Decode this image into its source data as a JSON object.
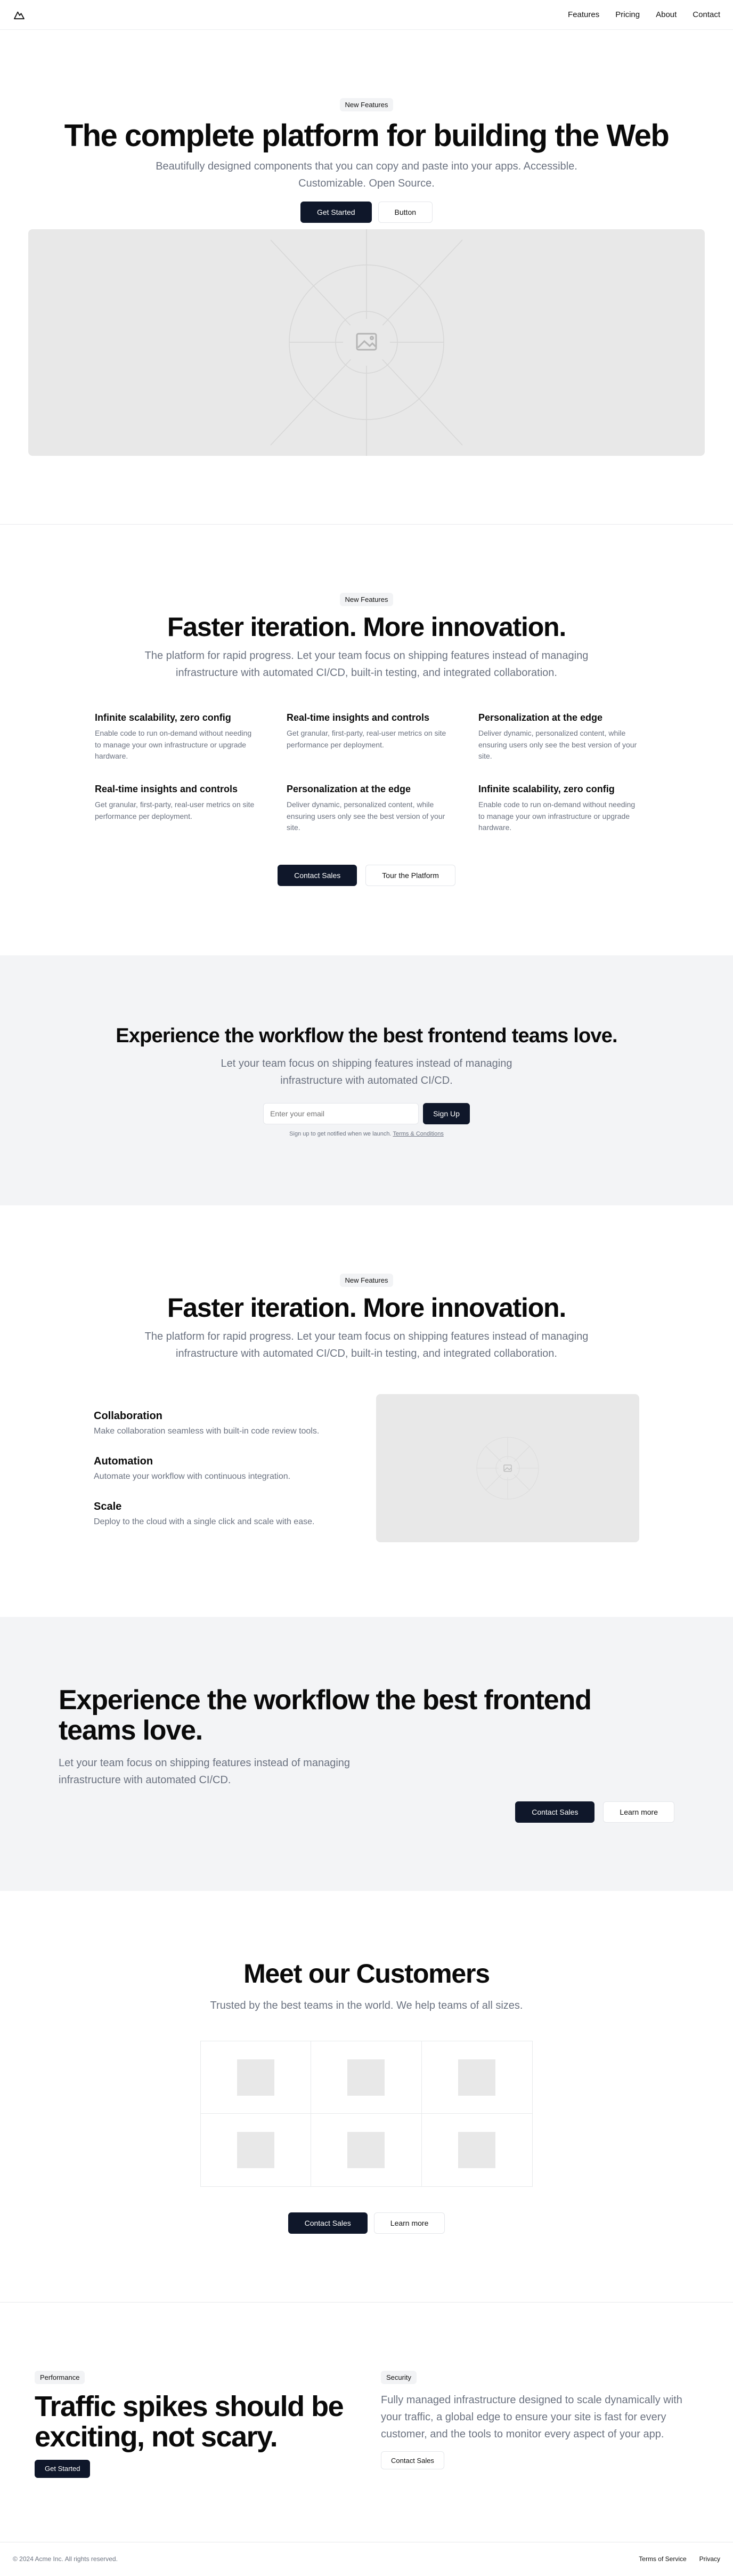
{
  "nav": {
    "items": [
      "Features",
      "Pricing",
      "About",
      "Contact"
    ]
  },
  "hero": {
    "badge": "New Features",
    "title": "The complete platform for building the Web",
    "subtitle": "Beautifully designed components that you can copy and paste into your apps. Accessible. Customizable. Open Source.",
    "primary": "Get Started",
    "secondary": "Button"
  },
  "features": {
    "badge": "New Features",
    "title": "Faster iteration. More innovation.",
    "subtitle": "The platform for rapid progress. Let your team focus on shipping features instead of managing infrastructure with automated CI/CD, built-in testing, and integrated collaboration.",
    "items": [
      {
        "title": "Infinite scalability, zero config",
        "desc": "Enable code to run on-demand without needing to manage your own infrastructure or upgrade hardware."
      },
      {
        "title": "Real-time insights and controls",
        "desc": "Get granular, first-party, real-user metrics on site performance per deployment."
      },
      {
        "title": "Personalization at the edge",
        "desc": "Deliver dynamic, personalized content, while ensuring users only see the best version of your site."
      },
      {
        "title": "Real-time insights and controls",
        "desc": "Get granular, first-party, real-user metrics on site performance per deployment."
      },
      {
        "title": "Personalization at the edge",
        "desc": "Deliver dynamic, personalized content, while ensuring users only see the best version of your site."
      },
      {
        "title": "Infinite scalability, zero config",
        "desc": "Enable code to run on-demand without needing to manage your own infrastructure or upgrade hardware."
      }
    ],
    "primary": "Contact Sales",
    "secondary": "Tour the Platform"
  },
  "cta_email": {
    "title": "Experience the workflow the best frontend teams love.",
    "subtitle": "Let your team focus on shipping features instead of managing infrastructure with automated CI/CD.",
    "placeholder": "Enter your email",
    "button": "Sign Up",
    "fineprint": "Sign up to get notified when we launch.",
    "terms": "Terms & Conditions"
  },
  "features2": {
    "badge": "New Features",
    "title": "Faster iteration. More innovation.",
    "subtitle": "The platform for rapid progress. Let your team focus on shipping features instead of managing infrastructure with automated CI/CD, built-in testing, and integrated collaboration.",
    "items": [
      {
        "title": "Collaboration",
        "desc": "Make collaboration seamless with built-in code review tools."
      },
      {
        "title": "Automation",
        "desc": "Automate your workflow with continuous integration."
      },
      {
        "title": "Scale",
        "desc": "Deploy to the cloud with a single click and scale with ease."
      }
    ]
  },
  "cta_large": {
    "title": "Experience the workflow the best frontend teams love.",
    "subtitle": "Let your team focus on shipping features instead of managing infrastructure with automated CI/CD.",
    "primary": "Contact Sales",
    "secondary": "Learn more"
  },
  "customers": {
    "title": "Meet our Customers",
    "subtitle": "Trusted by the best teams in the world. We help teams of all sizes.",
    "primary": "Contact Sales",
    "secondary": "Learn more"
  },
  "traffic": {
    "badge_left": "Performance",
    "title": "Traffic spikes should be exciting, not scary.",
    "primary": "Get Started",
    "badge_right": "Security",
    "desc": "Fully managed infrastructure designed to scale dynamically with your traffic, a global edge to ensure your site is fast for every customer, and the tools to monitor every aspect of your app.",
    "secondary": "Contact Sales"
  },
  "footer": {
    "copyright": "© 2024 Acme Inc. All rights reserved.",
    "links": [
      "Terms of Service",
      "Privacy"
    ]
  },
  "icons": {
    "logo": "mountain-icon",
    "placeholder": "image-icon"
  }
}
